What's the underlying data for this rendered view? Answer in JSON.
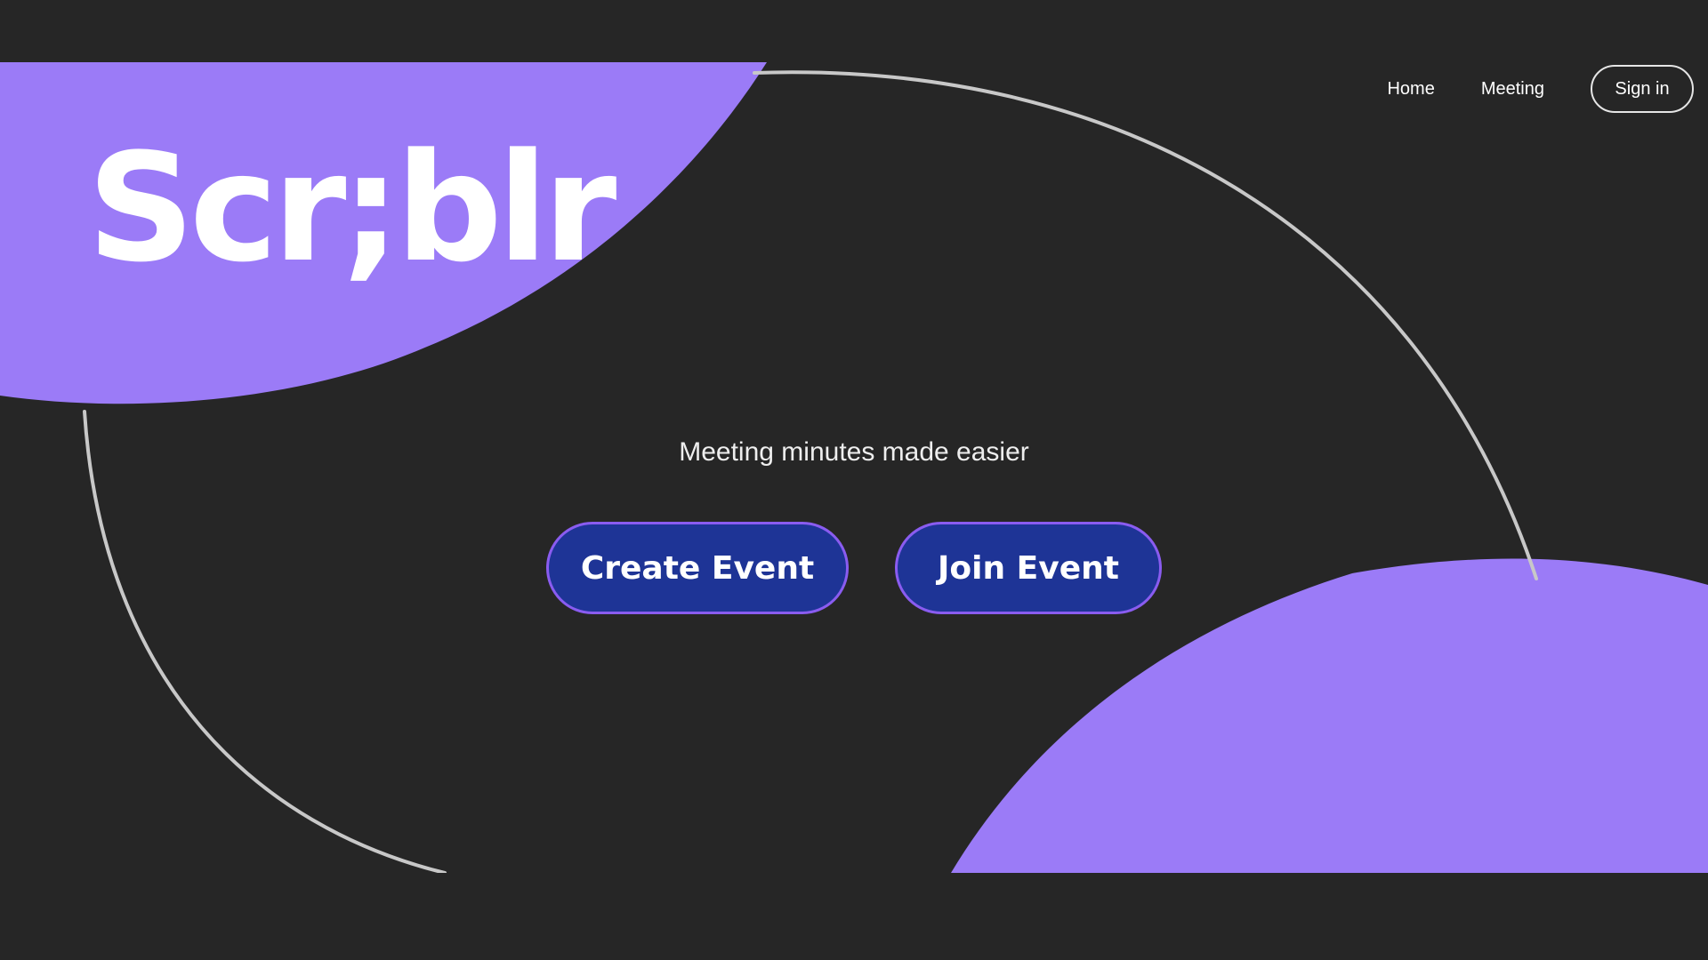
{
  "brand": {
    "logo_text": "Scr;blr"
  },
  "nav": {
    "home_label": "Home",
    "meeting_label": "Meeting",
    "signin_label": "Sign in"
  },
  "hero": {
    "tagline": "Meeting minutes made easier",
    "create_event_label": "Create Event",
    "join_event_label": "Join Event"
  },
  "colors": {
    "background": "#262626",
    "accent_purple": "#9b7bf7",
    "button_fill": "#1e3496",
    "button_border": "#8a5cf0",
    "arc_stroke": "#c8c8c8",
    "text": "#ffffff"
  }
}
